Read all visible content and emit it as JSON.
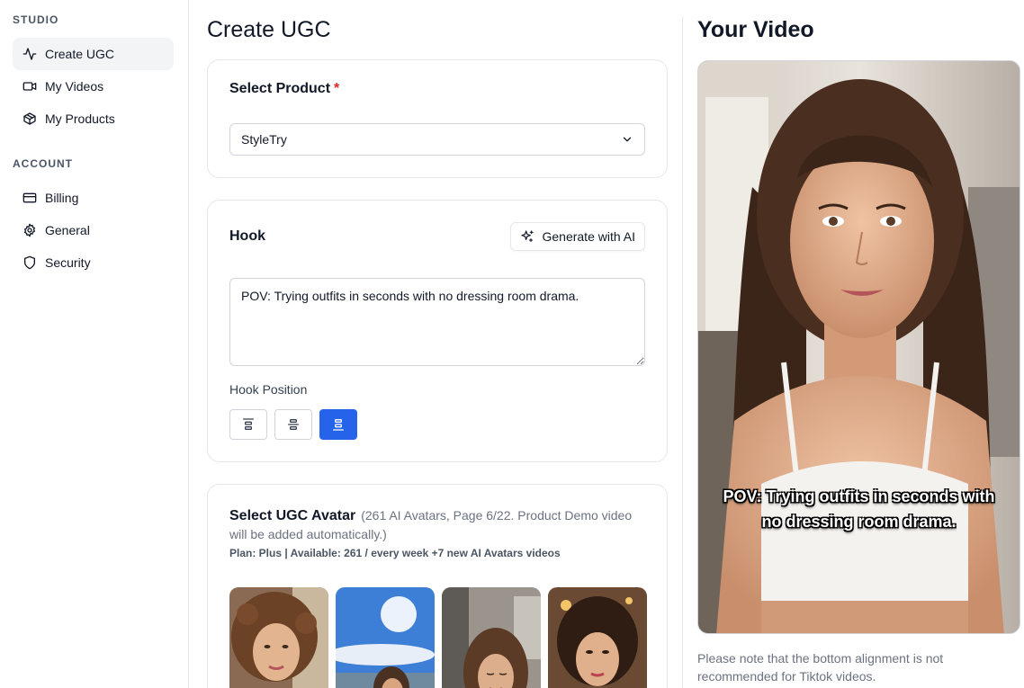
{
  "sidebar": {
    "studio_label": "STUDIO",
    "account_label": "ACCOUNT",
    "studio_items": [
      {
        "label": "Create UGC",
        "icon": "activity-icon",
        "active": true
      },
      {
        "label": "My Videos",
        "icon": "video-icon"
      },
      {
        "label": "My Products",
        "icon": "box-icon"
      }
    ],
    "account_items": [
      {
        "label": "Billing",
        "icon": "credit-card-icon"
      },
      {
        "label": "General",
        "icon": "gear-icon"
      },
      {
        "label": "Security",
        "icon": "shield-icon"
      }
    ]
  },
  "main": {
    "title": "Create UGC",
    "product": {
      "label": "Select Product",
      "required_mark": "*",
      "selected": "StyleTry"
    },
    "hook": {
      "label": "Hook",
      "generate_label": "Generate with AI",
      "text": "POV: Trying outfits in seconds with no dressing room drama.",
      "position_label": "Hook Position",
      "positions": [
        "top",
        "middle",
        "bottom"
      ],
      "selected_position": "bottom"
    },
    "avatar": {
      "label": "Select UGC Avatar",
      "info": "(261 AI Avatars, Page 6/22. Product Demo video will be added automatically.)",
      "plan": "Plan: Plus | Available: 261 / every week +7 new AI Avatars videos"
    }
  },
  "preview": {
    "title": "Your Video",
    "caption": "POV: Trying outfits in seconds with no dressing room drama.",
    "note": "Please note that the bottom alignment is not recommended for Tiktok videos."
  },
  "colors": {
    "accent": "#2563eb",
    "required": "#dc2626",
    "active_nav_bg": "#f3f4f6"
  }
}
